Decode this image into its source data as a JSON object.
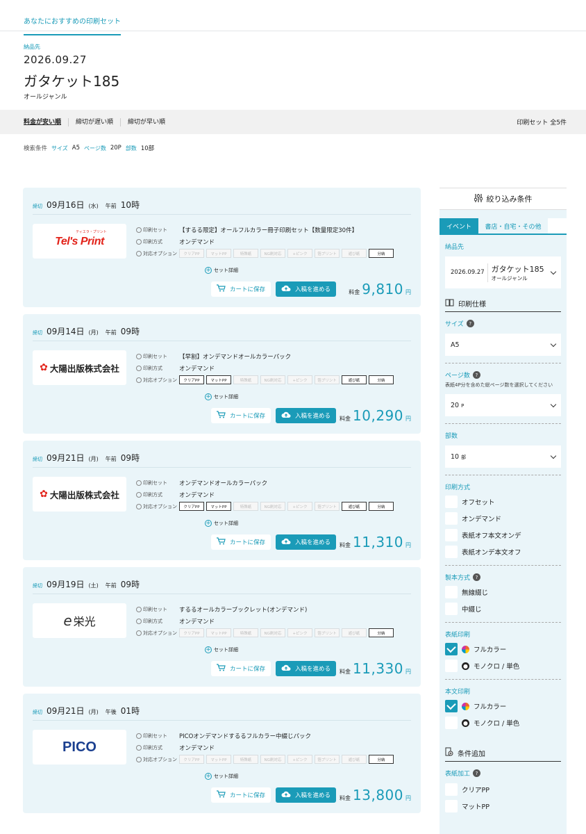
{
  "nav": {
    "tab": "あなたにおすすめの印刷セット"
  },
  "event": {
    "label": "納品先",
    "date": "2026.09.27",
    "name": "ガタケット185",
    "genre": "オールジャンル"
  },
  "sort": {
    "items": [
      "料金が安い順",
      "締切が遅い順",
      "締切が早い順"
    ],
    "count": "印刷セット 全5件"
  },
  "filter": {
    "label": "検索条件",
    "size_k": "サイズ",
    "size_v": "A5",
    "page_k": "ページ数",
    "page_v": "20P",
    "copies_k": "部数",
    "copies_v": "10部"
  },
  "card_labels": {
    "deadline": "締切",
    "set": "印刷セット",
    "method": "印刷方式",
    "options": "対応オプション",
    "detail": "セット詳細",
    "cart": "カートに保存",
    "submit": "入稿を進める",
    "price": "料金",
    "yen": "円"
  },
  "option_names": [
    "クリアPP",
    "マットPP",
    "特殊紙",
    "NG刷対応",
    "+ピンク",
    "箔プリント",
    "遊び紙",
    "分納"
  ],
  "cards": [
    {
      "date": "09月16日",
      "wday": "(水)",
      "ampm": "午前",
      "hour": "10時",
      "logo": "Tel's Print",
      "logo_sub": "ティエラ・プリント",
      "set": "【するる限定】オールフルカラー冊子印刷セット【数量限定30件】",
      "method": "オンデマンド",
      "opts": [
        0,
        0,
        0,
        0,
        0,
        0,
        0,
        1
      ],
      "price": "9,810"
    },
    {
      "date": "09月14日",
      "wday": "(月)",
      "ampm": "午前",
      "hour": "09時",
      "logo": "大陽出版株式会社",
      "set": "【早割】オンデマンドオールカラーパック",
      "method": "オンデマンド",
      "opts": [
        1,
        1,
        0,
        0,
        0,
        0,
        1,
        1
      ],
      "price": "10,290"
    },
    {
      "date": "09月21日",
      "wday": "(月)",
      "ampm": "午前",
      "hour": "09時",
      "logo": "大陽出版株式会社",
      "set": "オンデマンドオールカラーパック",
      "method": "オンデマンド",
      "opts": [
        1,
        1,
        0,
        0,
        0,
        0,
        1,
        1
      ],
      "price": "11,310"
    },
    {
      "date": "09月19日",
      "wday": "(土)",
      "ampm": "午前",
      "hour": "09時",
      "logo": "栄光",
      "set": "するるオールカラーブックレット(オンデマンド)",
      "method": "オンデマンド",
      "opts": [
        0,
        0,
        0,
        0,
        0,
        0,
        0,
        1
      ],
      "price": "11,330"
    },
    {
      "date": "09月21日",
      "wday": "(月)",
      "ampm": "午後",
      "hour": "01時",
      "logo": "PICO",
      "set": "PICOオンデマンドするるフルカラー中綴じパック",
      "method": "オンデマンド",
      "opts": [
        0,
        0,
        0,
        0,
        0,
        0,
        0,
        1
      ],
      "price": "13,800"
    }
  ],
  "side": {
    "title": "絞り込み条件",
    "tab1": "イベント",
    "tab2": "書店・自宅・その他",
    "deliv_label": "納品先",
    "deliv_date": "2026.09.27",
    "deliv_name": "ガタケット185",
    "deliv_genre": "オールジャンル",
    "spec": "印刷仕様",
    "size_label": "サイズ",
    "size_val": "A5",
    "page_label": "ページ数",
    "page_note": "表紙4P分を含めた総ページ数を選択してください",
    "page_val": "20",
    "page_unit": "P",
    "copies_label": "部数",
    "copies_val": "10",
    "copies_unit": "部",
    "method_label": "印刷方式",
    "methods": [
      "オフセット",
      "オンデマンド",
      "表紙オフ本文オンデ",
      "表紙オンデ本文オフ"
    ],
    "bind_label": "製本方式",
    "binds": [
      "無線綴じ",
      "中綴じ"
    ],
    "cover_label": "表紙印刷",
    "cover_full": "フルカラー",
    "cover_mono": "モノクロ / 単色",
    "body_label": "本文印刷",
    "body_full": "フルカラー",
    "body_mono": "モノクロ / 単色",
    "add": "条件追加",
    "finish_label": "表紙加工",
    "finish1": "クリアPP",
    "finish2": "マットPP"
  }
}
